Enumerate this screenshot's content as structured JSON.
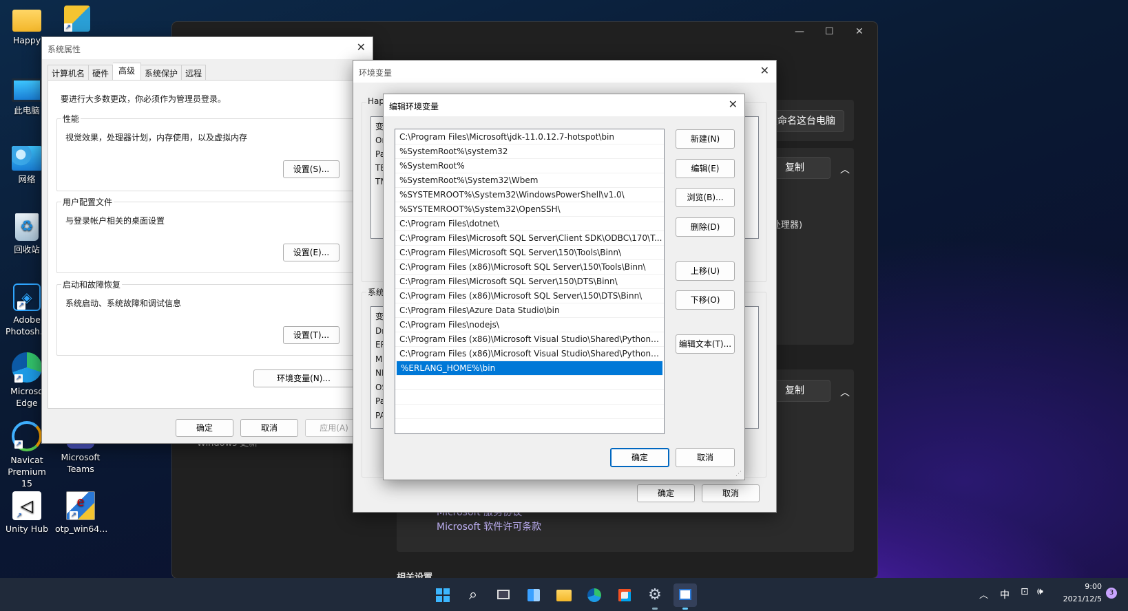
{
  "desktop": {
    "icons": [
      {
        "label": "Happy"
      },
      {
        "label": "此电脑"
      },
      {
        "label": "网络"
      },
      {
        "label": "回收站"
      },
      {
        "label": "Adobe Photosh..."
      },
      {
        "label": "Microso Edge"
      },
      {
        "label": "Navicat Premium 15"
      },
      {
        "label": "Unity Hub"
      },
      {
        "label": "Microsoft Teams"
      },
      {
        "label": "otp_win64..."
      }
    ]
  },
  "settings": {
    "rename_button": "重命名这台电脑",
    "copy_button_1": "复制",
    "copy_button_2": "复制",
    "processor_text": "个处理器)",
    "windows_update": "Windows 更新",
    "links": [
      "Microsoft 服务协议",
      "Microsoft 软件许可条款"
    ],
    "related_settings": "相关设置"
  },
  "sysprops": {
    "title": "系统属性",
    "tabs": [
      "计算机名",
      "硬件",
      "高级",
      "系统保护",
      "远程"
    ],
    "admin_note": "要进行大多数更改，你必须作为管理员登录。",
    "performance": {
      "label": "性能",
      "desc": "视觉效果，处理器计划，内存使用，以及虚拟内存",
      "button": "设置(S)..."
    },
    "profile": {
      "label": "用户配置文件",
      "desc": "与登录帐户相关的桌面设置",
      "button": "设置(E)..."
    },
    "startup": {
      "label": "启动和故障恢复",
      "desc": "系统启动、系统故障和调试信息",
      "button": "设置(T)..."
    },
    "env_button": "环境变量(N)...",
    "ok": "确定",
    "cancel": "取消",
    "apply": "应用(A)"
  },
  "envvars": {
    "title": "环境变量",
    "user_section": "Hap",
    "user_col": "变",
    "user_rows": [
      "Or",
      "Pa",
      "TE",
      "TM"
    ],
    "sys_section": "系统",
    "sys_col": "变",
    "sys_rows": [
      "Dr",
      "ER",
      "M",
      "NI",
      "OS",
      "Pa",
      "PA"
    ],
    "ok": "确定",
    "cancel": "取消"
  },
  "editenv": {
    "title": "编辑环境变量",
    "paths": [
      "C:\\Program Files\\Microsoft\\jdk-11.0.12.7-hotspot\\bin",
      "%SystemRoot%\\system32",
      "%SystemRoot%",
      "%SystemRoot%\\System32\\Wbem",
      "%SYSTEMROOT%\\System32\\WindowsPowerShell\\v1.0\\",
      "%SYSTEMROOT%\\System32\\OpenSSH\\",
      "C:\\Program Files\\dotnet\\",
      "C:\\Program Files\\Microsoft SQL Server\\Client SDK\\ODBC\\170\\T...",
      "C:\\Program Files\\Microsoft SQL Server\\150\\Tools\\Binn\\",
      "C:\\Program Files (x86)\\Microsoft SQL Server\\150\\Tools\\Binn\\",
      "C:\\Program Files\\Microsoft SQL Server\\150\\DTS\\Binn\\",
      "C:\\Program Files (x86)\\Microsoft SQL Server\\150\\DTS\\Binn\\",
      "C:\\Program Files\\Azure Data Studio\\bin",
      "C:\\Program Files\\nodejs\\",
      "C:\\Program Files (x86)\\Microsoft Visual Studio\\Shared\\Python3...",
      "C:\\Program Files (x86)\\Microsoft Visual Studio\\Shared\\Python3...",
      "%ERLANG_HOME%\\bin"
    ],
    "selected_index": 16,
    "buttons": {
      "new": "新建(N)",
      "edit": "编辑(E)",
      "browse": "浏览(B)...",
      "delete": "删除(D)",
      "up": "上移(U)",
      "down": "下移(O)",
      "edit_text": "编辑文本(T)..."
    },
    "ok": "确定",
    "cancel": "取消"
  },
  "taskbar": {
    "time": "9:00",
    "date": "2021/12/5",
    "ime": "中",
    "notifications": "3"
  },
  "colors": {
    "accent": "#0078d7",
    "selected_row": "#0078d7",
    "settings_bg": "#202020"
  }
}
